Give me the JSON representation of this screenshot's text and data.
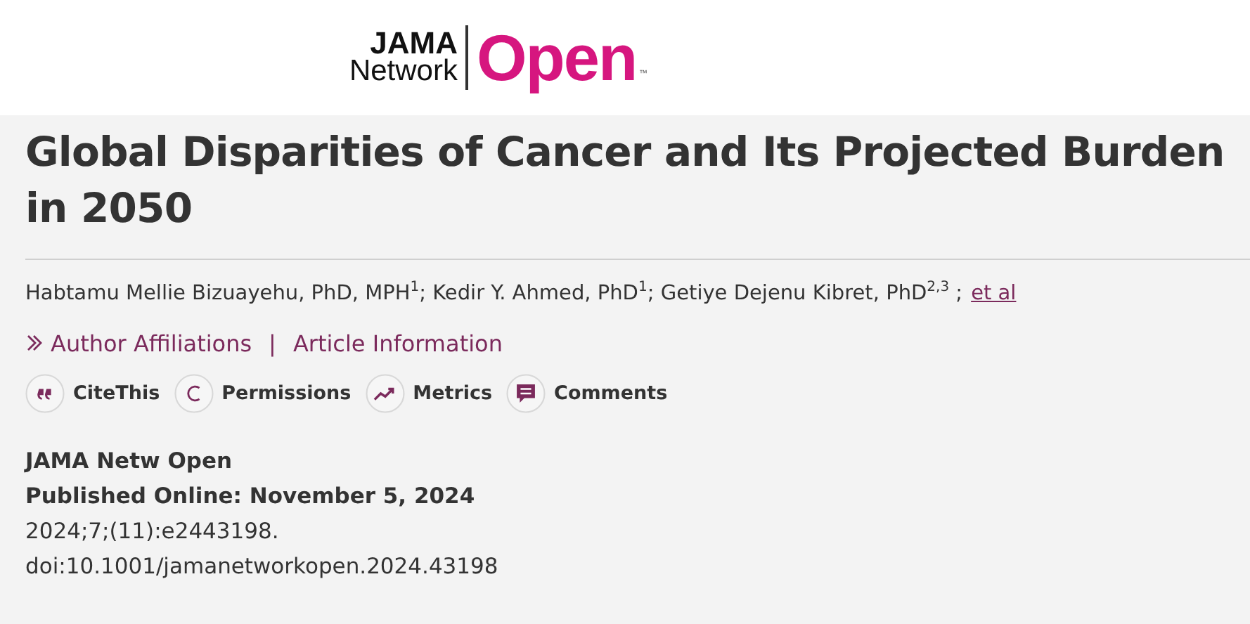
{
  "logo": {
    "line_1": "JAMA",
    "line_2": "Network",
    "brand": "Open",
    "mark": "™"
  },
  "title": "Global Disparities of Cancer and Its Projected Burden in 2050",
  "authors": {
    "text": "Habtamu Mellie Bizuayehu, PhD, MPH$^{1}$; Kedir Y. Ahmed, PhD$^{1}$; Getiye Dejenu Kibret, PhD$^{2,3}$ ;",
    "more_link": "et al"
  },
  "info_links": [
    {
      "label": "Author Affiliations",
      "kind": "expand"
    },
    {
      "label": "Article Information",
      "kind": "plain"
    }
  ],
  "separator": "|",
  "actions": [
    {
      "label": "CiteThis",
      "kind": "quote"
    },
    {
      "label": "Permissions",
      "kind": "permissions"
    },
    {
      "label": "Metrics",
      "kind": "metrics"
    },
    {
      "label": "Comments",
      "kind": "comments"
    }
  ],
  "meta": {
    "journal": "JAMA Netw Open",
    "published": "Published Online: November 5, 2024",
    "citation": "2024;7;(11):e2443198.",
    "doi": "doi:10.1001/jamanetworkopen.2024.43198"
  }
}
